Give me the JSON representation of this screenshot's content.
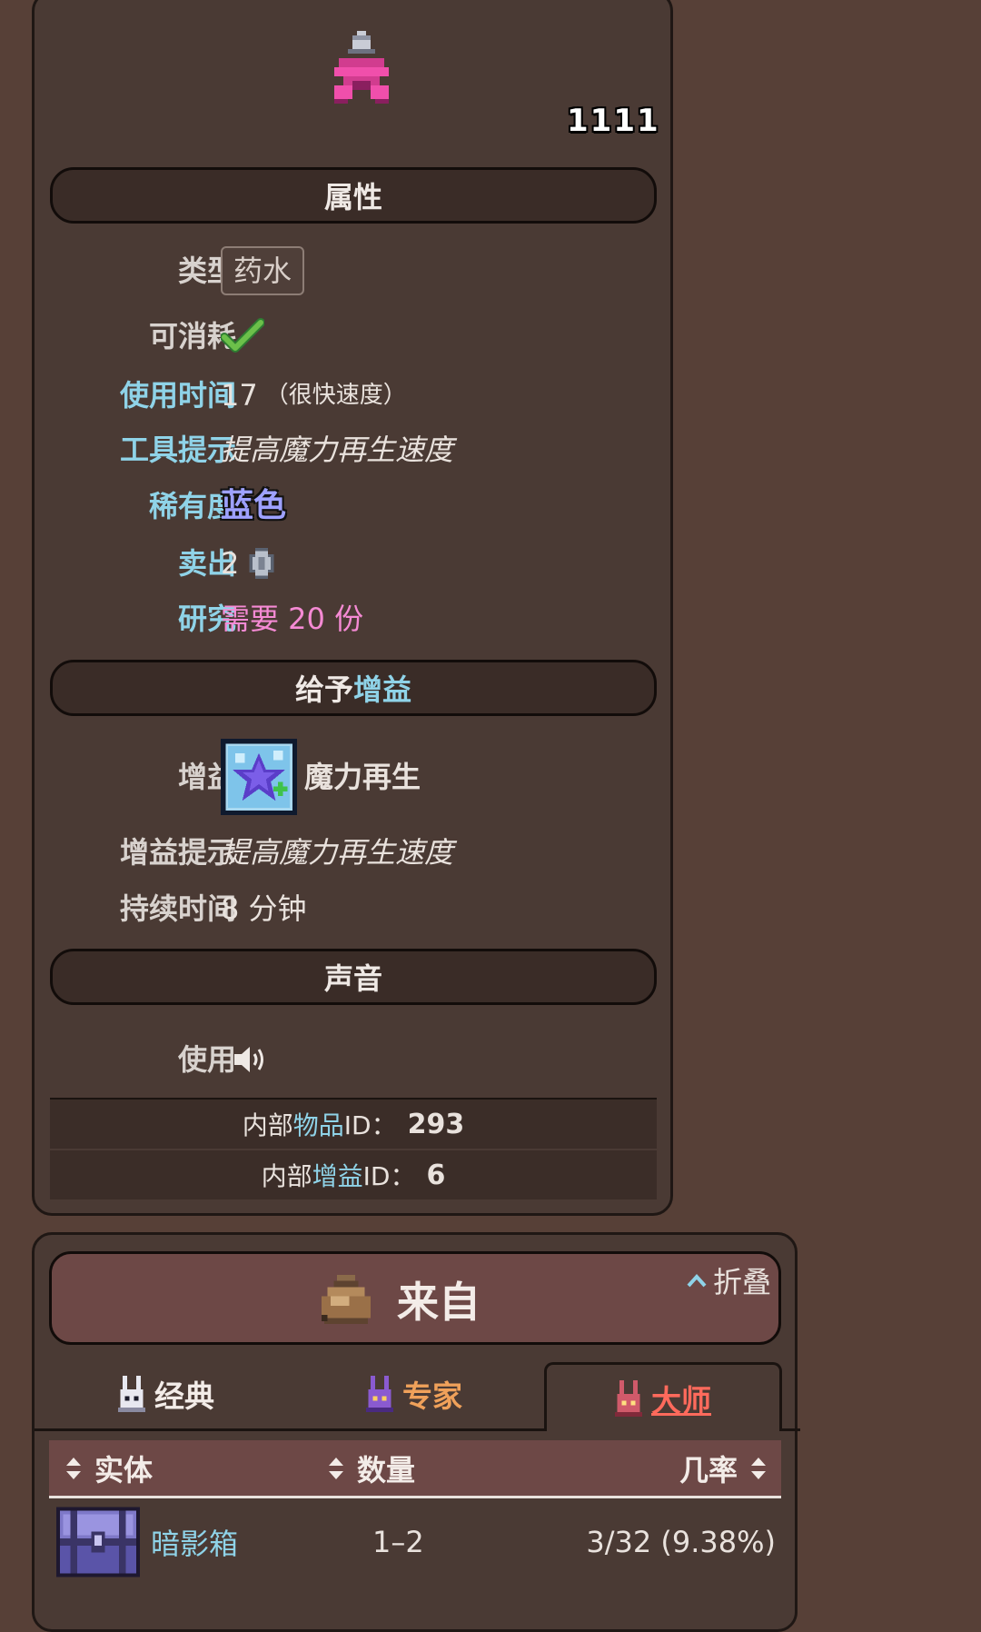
{
  "item": {
    "stack_count": "1111",
    "sections": {
      "properties": "属性",
      "buff_prefix": "给予",
      "buff_highlight": "增益",
      "sound": "声音"
    },
    "props": {
      "type_label": "类型",
      "type_value": "药水",
      "consumable_label": "可消耗",
      "use_time_label": "使用时间",
      "use_time_value": "17",
      "use_time_note": "（很快速度）",
      "tooltip_label": "工具提示",
      "tooltip_value": "提高魔力再生速度",
      "rarity_label": "稀有度",
      "rarity_value": "蓝色",
      "sell_label": "卖出",
      "sell_value": "2",
      "research_label": "研究",
      "research_value": "需要 20 份"
    },
    "buff": {
      "buff_label": "增益",
      "buff_name": "魔力再生",
      "buff_tip_label": "增益提示",
      "buff_tip_value": "提高魔力再生速度",
      "duration_label": "持续时间",
      "duration_value": "8 分钟"
    },
    "sound": {
      "use_label": "使用"
    },
    "ids": {
      "item_id_prefix": "内部",
      "item_id_hl": "物品",
      "item_id_suffix": " ID：",
      "item_id_value": "293",
      "buff_id_prefix": "内部",
      "buff_id_hl": "增益",
      "buff_id_suffix": " ID：",
      "buff_id_value": "6"
    }
  },
  "source": {
    "title": "来自",
    "collapse_label": "折叠",
    "tabs": [
      {
        "label": "经典",
        "color": "#f3ece8"
      },
      {
        "label": "专家",
        "color": "#f0a15a"
      },
      {
        "label": "大师",
        "color": "#ff6a5c"
      }
    ],
    "columns": {
      "entity": "实体",
      "quantity": "数量",
      "chance": "几率"
    },
    "rows": [
      {
        "entity": "暗影箱",
        "quantity": "1–2",
        "chance": "3/32 (9.38%)"
      }
    ]
  },
  "colors": {
    "background": "#574037",
    "panel": "#4a3a34",
    "header_red": "#6d4846",
    "accent_cyan": "#8fd3e8",
    "research_pink": "#f58ad4",
    "rarity_blue": "#9ea1ff"
  },
  "icons": [
    "potion-icon",
    "check-icon",
    "silver-coin-icon",
    "mana-regen-buff-icon",
    "speaker-icon",
    "bag-icon",
    "chevron-up-icon",
    "bunny-classic-icon",
    "bunny-expert-icon",
    "bunny-master-icon",
    "sort-icon",
    "shadow-chest-icon"
  ]
}
